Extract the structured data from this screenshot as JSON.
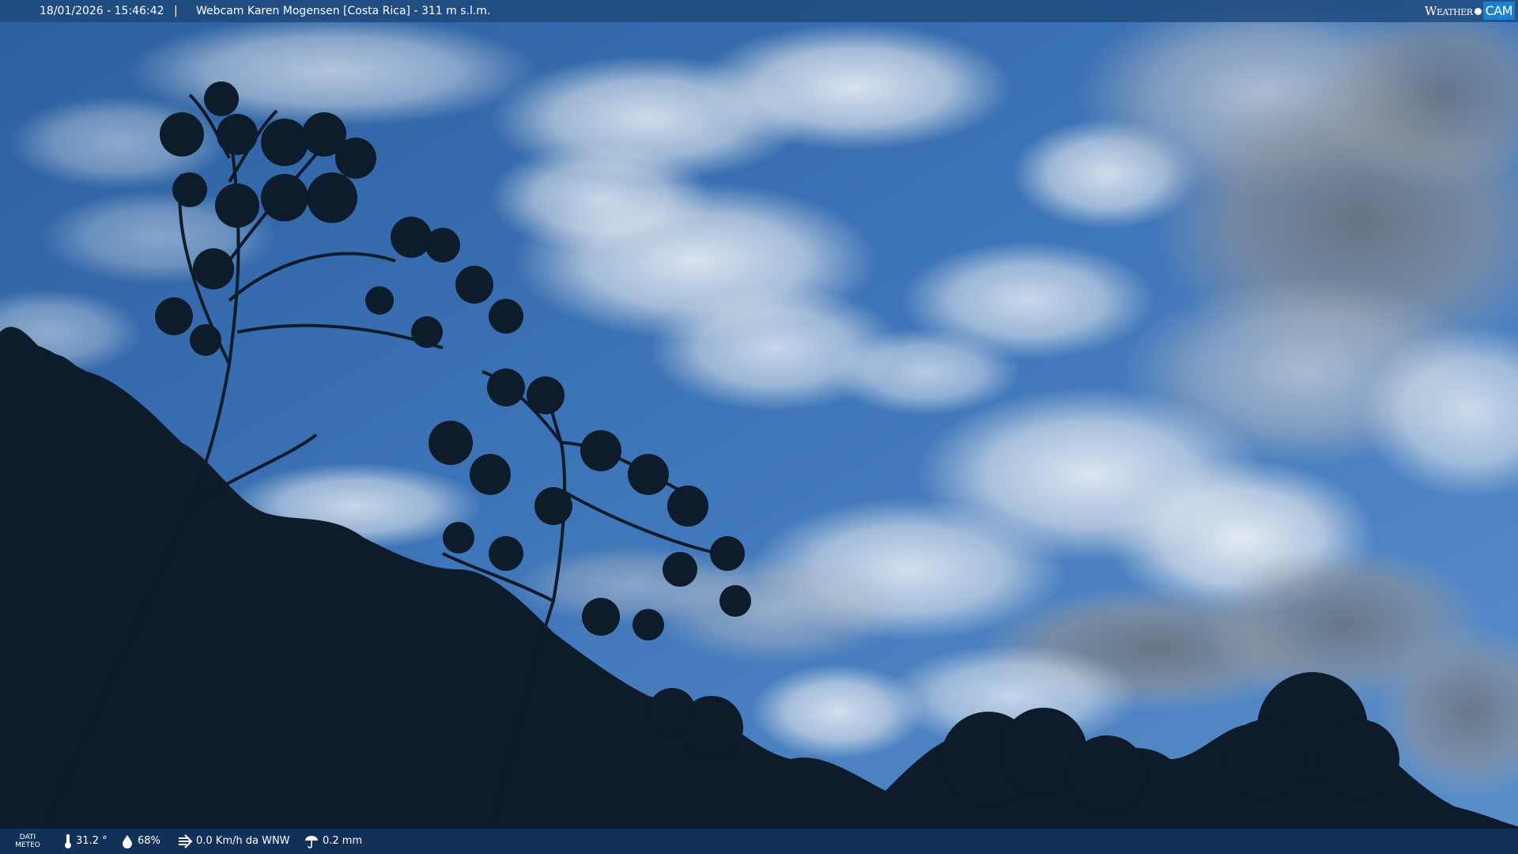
{
  "header": {
    "timestamp": "18/01/2026 - 15:46:42",
    "separator": "|",
    "title": "Webcam Karen Mogensen [Costa Rica] - 311 m s.l.m."
  },
  "logo": {
    "weather_text": "Weather",
    "cam_text": "CAM",
    "accent_color": "#1d7fd0"
  },
  "footer": {
    "dati_line1": "DATI",
    "dati_line2": "METEO",
    "temperature": "31.2 °",
    "humidity": "68%",
    "wind": "0.0 Km/h da WNW",
    "rain": "0.2 mm"
  },
  "icons": {
    "temperature": "thermometer-icon",
    "humidity": "humidity-icon",
    "wind": "wind-icon",
    "rain": "rain-icon"
  }
}
